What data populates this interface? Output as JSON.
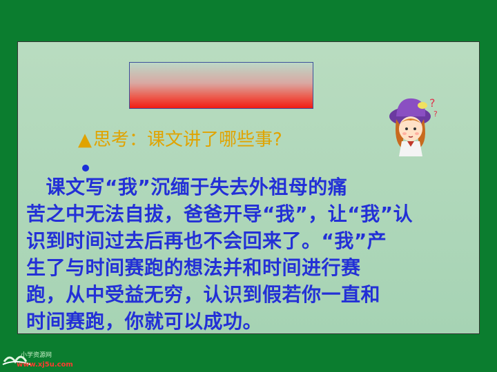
{
  "slide": {
    "question_marker": "▲",
    "question": "思考：课文讲了哪些事?",
    "bullet_marker": "•",
    "body_lines": [
      "　课文写“我”沉缅于失去外祖母的痛",
      "苦之中无法自拔，爸爸开导“我”，让“我”认",
      "识到时间过去后再也不会回来了。“我”产",
      "生了与时间赛跑的想法并和时间进行赛",
      "跑，从中受益无穷，认识到假若你一直和",
      "时间赛跑，你就可以成功。"
    ]
  },
  "logo": {
    "site_name": "小学资源网",
    "url": "www.xj5u.com"
  },
  "colors": {
    "background": "#0b7d2f",
    "question": "#e0a300",
    "body_text": "#2330d6"
  }
}
